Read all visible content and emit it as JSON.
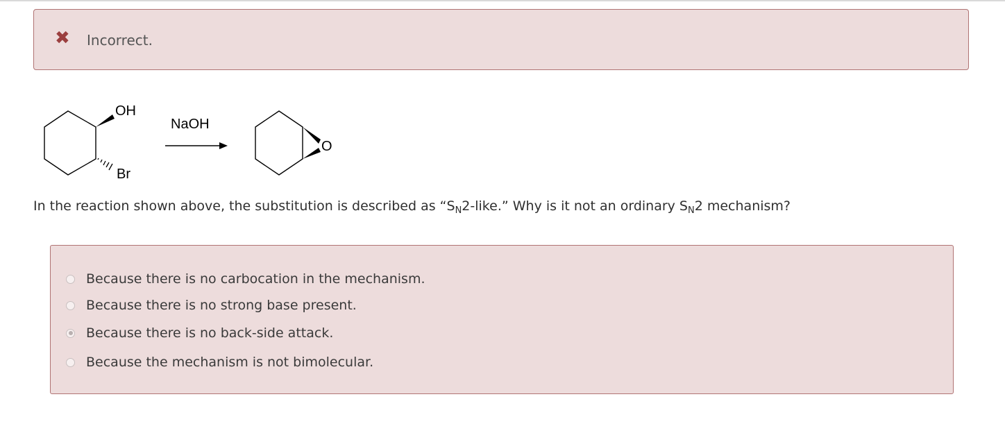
{
  "alert": {
    "icon": "x-mark-icon",
    "message": "Incorrect."
  },
  "reaction": {
    "reactant_labels": {
      "oh": "OH",
      "br": "Br"
    },
    "reagent": "NaOH",
    "product_label": "O"
  },
  "question": {
    "part1": "In the reaction shown above, the substitution is described as “S",
    "sub1": "N",
    "part2": "2-like.” Why is it not an ordinary S",
    "sub2": "N",
    "part3": "2 mechanism?"
  },
  "options": [
    {
      "label": "Because there is no carbocation in the mechanism.",
      "selected": false
    },
    {
      "label": "Because there is no strong base present.",
      "selected": false
    },
    {
      "label": "Because there is no back-side attack.",
      "selected": true
    },
    {
      "label": "Because the mechanism is not bimolecular.",
      "selected": false
    }
  ],
  "colors": {
    "alert_background": "#eddcdc",
    "alert_border": "#b07373",
    "error_icon": "#9b3f3f"
  }
}
